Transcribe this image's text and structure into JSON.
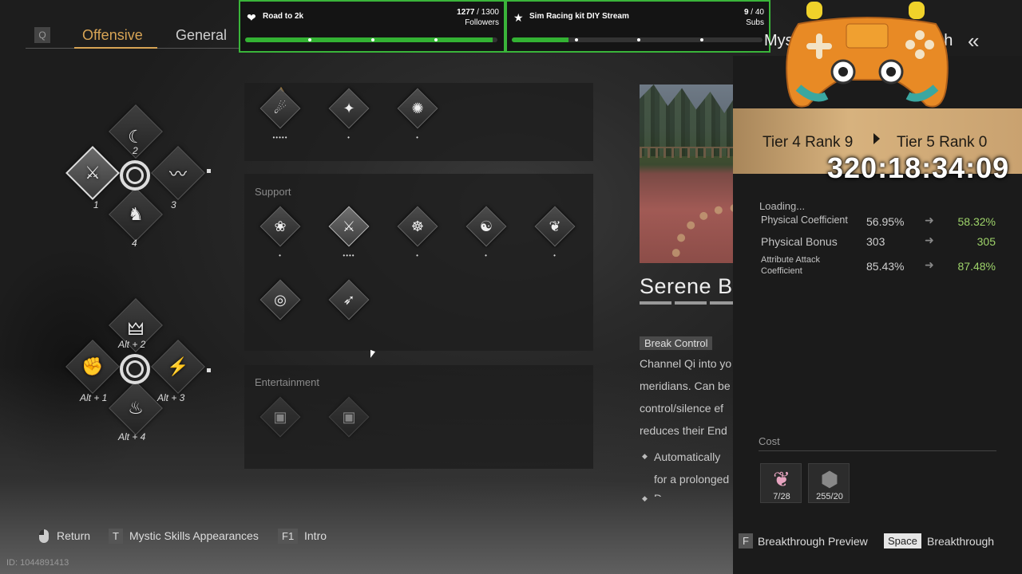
{
  "tabs": {
    "key": "Q",
    "items": [
      "Offensive",
      "General"
    ]
  },
  "stream_goals": [
    {
      "icon": "heart-icon",
      "title": "Road to 2k",
      "current": "1277",
      "target": "1300",
      "unit": "Followers",
      "progress": 0.98
    },
    {
      "icon": "star-icon",
      "title": "Sim Racing kit DIY Stream",
      "current": "9",
      "target": "40",
      "unit": "Subs",
      "progress": 0.225
    }
  ],
  "wheel_primary": {
    "slots": [
      "1",
      "2",
      "3",
      "4"
    ]
  },
  "wheel_alt": {
    "slots": [
      "Alt + 1",
      "Alt + 2",
      "Alt + 3",
      "Alt + 4"
    ]
  },
  "panels": {
    "offensive_pips": [
      "•••••",
      "•",
      "•"
    ],
    "support_title": "Support",
    "support_pips": [
      "•",
      "••••",
      "•",
      "•",
      "•"
    ],
    "entertainment_title": "Entertainment"
  },
  "skill": {
    "name": "Serene Br",
    "tag": "Break Control",
    "desc_lines": [
      "Channel Qi into yo",
      "meridians. Can be",
      "control/silence ef",
      "reduces their End"
    ],
    "bullets": [
      "Automatically",
      "for a prolonged"
    ],
    "bullet_cut": "D"
  },
  "breakthrough": {
    "header_left": "Myst",
    "header_right": "ugh",
    "tier_from": "Tier 4 Rank 9",
    "tier_to": "Tier 5 Rank 0",
    "timer": "320:18:34:09",
    "loading": "Loading...",
    "stats": [
      {
        "name": "Physical Coefficient",
        "from": "56.95%",
        "to": "58.32%"
      },
      {
        "name": "Physical Bonus",
        "from": "303",
        "to": "305"
      },
      {
        "name": "Attribute Attack Coefficient",
        "from": "85.43%",
        "to": "87.48%"
      }
    ],
    "cost_label": "Cost",
    "cost_items": [
      {
        "icon": "feather-icon",
        "qty": "7/28",
        "color": "#e7a4c0"
      },
      {
        "icon": "ore-icon",
        "qty": "255/20",
        "color": "#888888"
      }
    ]
  },
  "bottom_bar": {
    "return_label": "Return",
    "appearances_key": "T",
    "appearances_label": "Mystic Skills Appearances",
    "intro_key": "F1",
    "intro_label": "Intro",
    "preview_key": "F",
    "preview_label": "Breakthrough Preview",
    "breakthrough_key": "Space",
    "breakthrough_label": "Breakthrough"
  },
  "uid": "ID: 1044891413",
  "colors": {
    "accent": "#d7a455",
    "goal_green": "#3ab53a",
    "stat_up": "#9ed36a",
    "gold_banner": "#d7b27e"
  }
}
